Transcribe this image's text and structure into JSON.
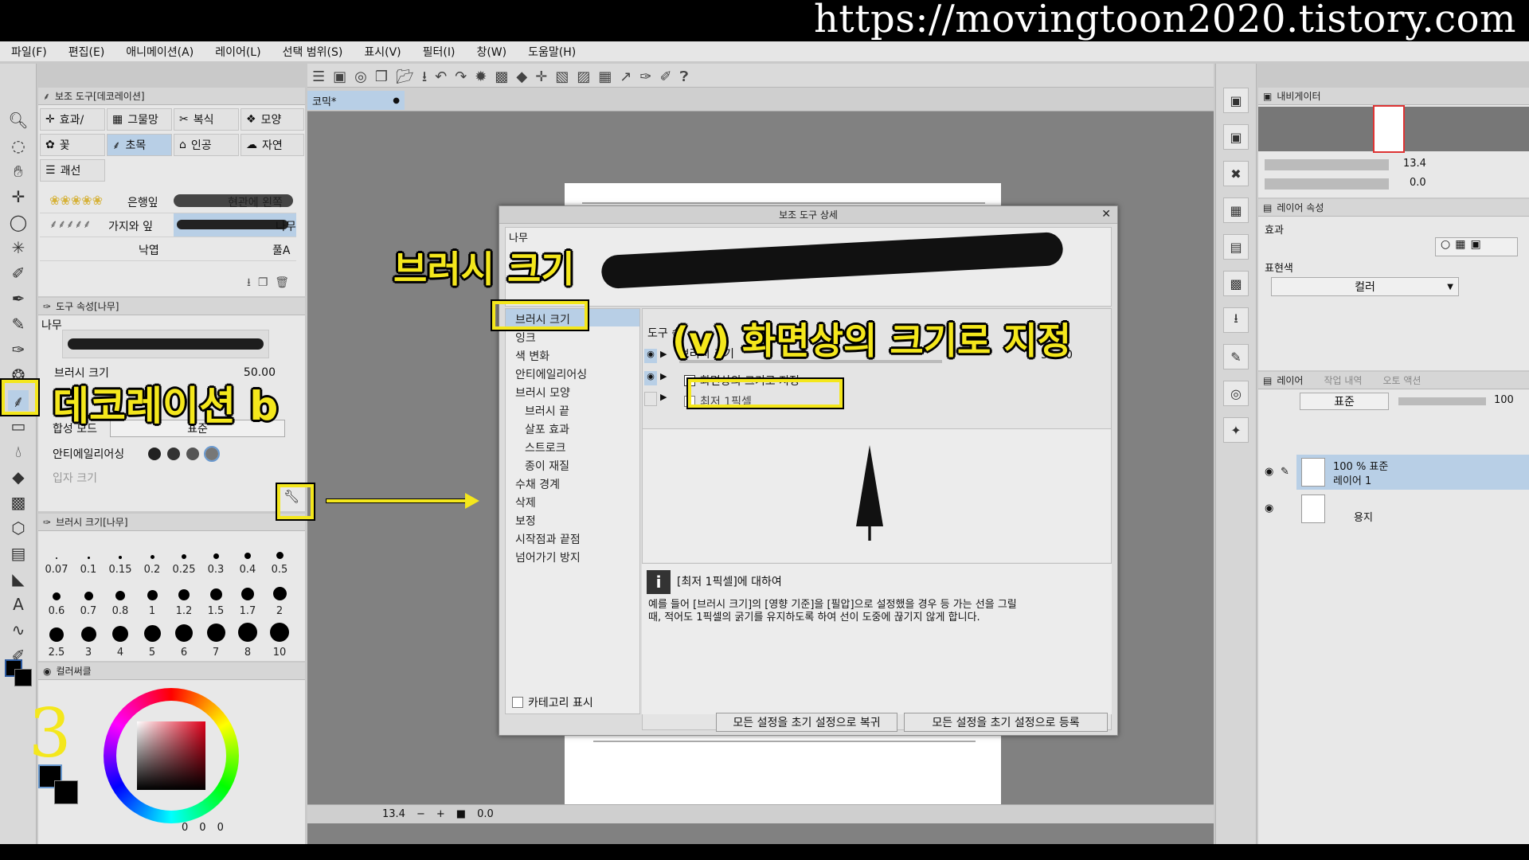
{
  "banner": {
    "url": "https://movingtoon2020.tistory.com"
  },
  "menu": [
    "파일(F)",
    "편집(E)",
    "애니메이션(A)",
    "레이어(L)",
    "선택 범위(S)",
    "표시(V)",
    "필터(I)",
    "창(W)",
    "도움말(H)"
  ],
  "subtool": {
    "title": "보조 도구[데코레이션]",
    "groups": [
      "효과/",
      "그물망",
      "복식",
      "모양",
      "꽃",
      "초목",
      "인공",
      "자연",
      "괘선"
    ],
    "brushes": [
      "은행잎",
      "현관에 왼쪽",
      "가지와 잎",
      "나무",
      "낙엽",
      "풀A"
    ]
  },
  "toolprop": {
    "title": "도구 속성[나무]",
    "brush_name": "나무",
    "size_label": "브러시 크기",
    "size_value": "50.00",
    "blend_label": "합성 모드",
    "blend_value": "표준",
    "aa_label": "안티에일리어싱",
    "extra_label": "입자 크기"
  },
  "brushsize": {
    "title": "브러시 크기[나무]",
    "sizes": [
      "0.07",
      "0.1",
      "0.15",
      "0.2",
      "0.25",
      "0.3",
      "0.4",
      "0.5",
      "0.6",
      "0.7",
      "0.8",
      "1",
      "1.2",
      "1.5",
      "1.7",
      "2",
      "2.5",
      "3",
      "4",
      "5",
      "6",
      "7",
      "8",
      "10"
    ]
  },
  "color": {
    "title": "컬러써클",
    "values": [
      "0",
      "0",
      "0"
    ],
    "fg": "#000000",
    "bg": "#000000"
  },
  "canvas": {
    "tab": "코믹*",
    "zoom": "13.4",
    "angle": "0.0"
  },
  "nav": {
    "title": "내비게이터",
    "zoom": "13.4",
    "angle": "0.0"
  },
  "layerprop": {
    "title": "레이어 속성",
    "effect_label": "효과",
    "expr_label": "표현색",
    "expr_value": "컬러"
  },
  "layers": {
    "tabs": [
      "레이어",
      "작업 내역",
      "오토 액션"
    ],
    "blend": "표준",
    "opacity": "100",
    "items": [
      {
        "line1": "100 % 표준",
        "line2": "레이어 1"
      },
      {
        "line1": "",
        "line2": "용지"
      }
    ]
  },
  "dialog": {
    "title": "보조 도구 상세",
    "preview_label": "나무",
    "categories": [
      "브러시 크기",
      "잉크",
      "색 변화",
      "안티에일리어싱",
      "브러시 모양",
      "브러시 끝",
      "살포 효과",
      "스트로크",
      "종이 재질",
      "수채 경계",
      "삭제",
      "보정",
      "시작점과 끝점",
      "넘어가기 방지"
    ],
    "section_label": "도구 속",
    "size_label": "브러시 크기",
    "size_value": "50.00",
    "checkbox_screen": "화면상의 크기로 지정",
    "checkbox_min": "최저 1픽셀",
    "info_title": "[최저 1픽셀]에 대하여",
    "info_body_1": "예를 들어 [브러시 크기]의 [영향 기준]을 [필압]으로 설정했을 경우 등 가는 선을 그릴",
    "info_body_2": "때, 적어도 1픽셀의 굵기를 유지하도록 하여 선이 도중에 끊기지 않게 합니다.",
    "show_category": "카테고리 표시",
    "reset_btn": "모든 설정을 초기 설정으로 복귀",
    "register_btn": "모든 설정을 초기 설정으로 등록"
  },
  "annotations": {
    "brush_size": "브러시 크기",
    "screen_size": "(v) 화면상의 크기로 지정",
    "decoration": "데코레이션  b",
    "step": "3"
  },
  "colors": {
    "highlight": "#f4e71c",
    "selection": "#b8cfe6"
  }
}
